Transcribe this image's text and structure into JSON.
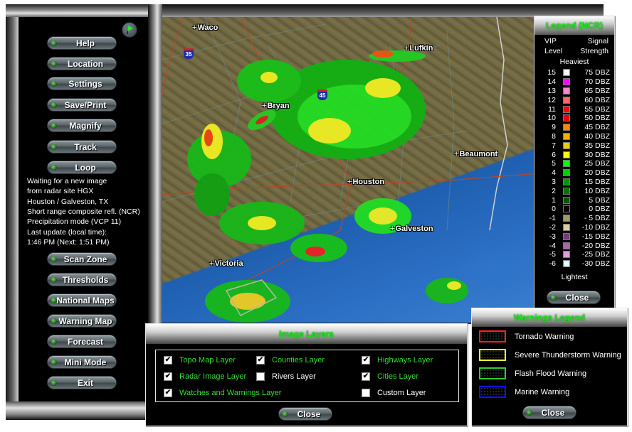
{
  "sidebar": {
    "buttons_top": [
      {
        "label": "Help"
      },
      {
        "label": "Location"
      },
      {
        "label": "Settings"
      },
      {
        "label": "Save/Print"
      },
      {
        "label": "Magnify"
      },
      {
        "label": "Track"
      },
      {
        "label": "Loop"
      }
    ],
    "status_lines": [
      "Waiting for a new image",
      "from radar site HGX",
      "Houston / Galveston, TX",
      "Short range composite refl. (NCR)",
      "Precipitation mode (VCP 11)",
      "Last update (local time):",
      "1:46 PM (Next: 1:51 PM)"
    ],
    "buttons_bottom": [
      {
        "label": "Scan Zone"
      },
      {
        "label": "Thresholds"
      },
      {
        "label": "National Maps"
      },
      {
        "label": "Warning Map"
      },
      {
        "label": "Forecast"
      },
      {
        "label": "Mini Mode"
      },
      {
        "label": "Exit"
      }
    ],
    "flag_icon": "green-flag-icon"
  },
  "map": {
    "cities": [
      {
        "name": "Waco"
      },
      {
        "name": "Lufkin"
      },
      {
        "name": "Bryan"
      },
      {
        "name": "Beaumont"
      },
      {
        "name": "Houston"
      },
      {
        "name": "Galveston"
      },
      {
        "name": "Victoria"
      }
    ],
    "interstates": [
      {
        "label": "35"
      },
      {
        "label": "45"
      }
    ]
  },
  "legend": {
    "title": "Legend (NCR)",
    "col1_header_1": "VIP",
    "col1_header_2": "Level",
    "col2_header_1": "Signal",
    "col2_header_2": "Strength",
    "top_label": "Heaviest",
    "bottom_label": "Lightest",
    "close_label": "Close",
    "rows": [
      {
        "level": "15",
        "dbz": "75 DBZ",
        "color": "#ffffff"
      },
      {
        "level": "14",
        "dbz": "70 DBZ",
        "color": "#ff00ff"
      },
      {
        "level": "13",
        "dbz": "65 DBZ",
        "color": "#ff88cc"
      },
      {
        "level": "12",
        "dbz": "60 DBZ",
        "color": "#ff6666"
      },
      {
        "level": "11",
        "dbz": "55 DBZ",
        "color": "#ff0000"
      },
      {
        "level": "10",
        "dbz": "50 DBZ",
        "color": "#ee0000"
      },
      {
        "level": "9",
        "dbz": "45 DBZ",
        "color": "#ff8800"
      },
      {
        "level": "8",
        "dbz": "40 DBZ",
        "color": "#ffaa00"
      },
      {
        "level": "7",
        "dbz": "35 DBZ",
        "color": "#eecc00"
      },
      {
        "level": "6",
        "dbz": "30 DBZ",
        "color": "#ffff00"
      },
      {
        "level": "5",
        "dbz": "25 DBZ",
        "color": "#00ff00"
      },
      {
        "level": "4",
        "dbz": "20 DBZ",
        "color": "#00cc00"
      },
      {
        "level": "3",
        "dbz": "15 DBZ",
        "color": "#009900"
      },
      {
        "level": "2",
        "dbz": "10 DBZ",
        "color": "#007700"
      },
      {
        "level": "1",
        "dbz": "5 DBZ",
        "color": "#005500"
      },
      {
        "level": "0",
        "dbz": "0 DBZ",
        "color": "#000000"
      },
      {
        "level": "-1",
        "dbz": "- 5 DBZ",
        "color": "#9c9a6a"
      },
      {
        "level": "-2",
        "dbz": "-10 DBZ",
        "color": "#d8d098"
      },
      {
        "level": "-3",
        "dbz": "-15 DBZ",
        "color": "#7a3a7a"
      },
      {
        "level": "-4",
        "dbz": "-20 DBZ",
        "color": "#aa66aa"
      },
      {
        "level": "-5",
        "dbz": "-25 DBZ",
        "color": "#dda0dd"
      },
      {
        "level": "-6",
        "dbz": "-30 DBZ",
        "color": "#ddffff"
      }
    ]
  },
  "image_layers": {
    "title": "Image Layers",
    "close_label": "Close",
    "layers": [
      {
        "label": "Topo Map Layer",
        "checked": true
      },
      {
        "label": "Counties Layer",
        "checked": true
      },
      {
        "label": "Highways Layer",
        "checked": true
      },
      {
        "label": "Radar Image Layer",
        "checked": true
      },
      {
        "label": "Rivers Layer",
        "checked": false
      },
      {
        "label": "Cities Layer",
        "checked": true
      },
      {
        "label": "Watches and Warnings Layer",
        "checked": true
      },
      {
        "label": "Custom Layer",
        "checked": false
      }
    ]
  },
  "warnings_legend": {
    "title": "Warnings Legend",
    "close_label": "Close",
    "items": [
      {
        "label": "Tornado Warning",
        "color": "#ff2222"
      },
      {
        "label": "Severe Thunderstorm Warning",
        "color": "#ffff33"
      },
      {
        "label": "Flash Flood Warning",
        "color": "#33cc33"
      },
      {
        "label": "Marine Warning",
        "color": "#1111ff"
      }
    ]
  }
}
